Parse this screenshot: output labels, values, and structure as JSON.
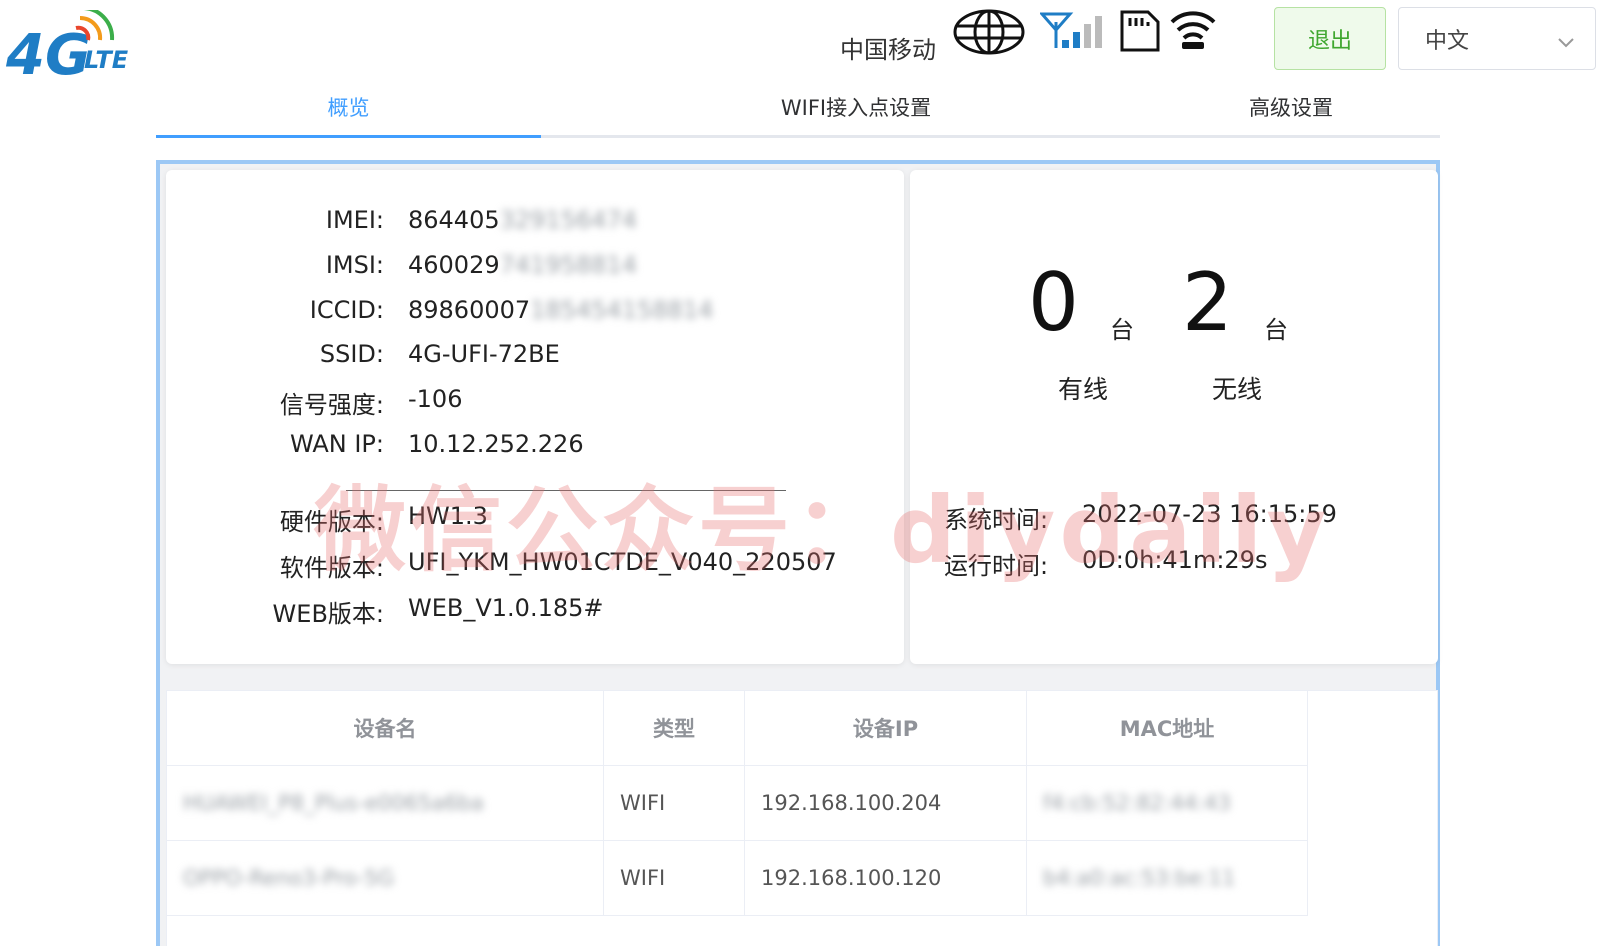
{
  "header": {
    "logo_text": "4G LTE",
    "operator": "中国移动",
    "logout_label": "退出",
    "language": "中文"
  },
  "tabs": [
    {
      "label": "概览",
      "active": true
    },
    {
      "label": "WIFI接入点设置",
      "active": false
    },
    {
      "label": "高级设置",
      "active": false
    }
  ],
  "info": {
    "imei": {
      "label": "IMEI:",
      "value": "864405",
      "hidden": "329156474"
    },
    "imsi": {
      "label": "IMSI:",
      "value": "460029",
      "hidden": "741958814"
    },
    "iccid": {
      "label": "ICCID:",
      "value": "89860007",
      "hidden": "185454158814"
    },
    "ssid": {
      "label": "SSID:",
      "value": "4G-UFI-72BE"
    },
    "signal": {
      "label": "信号强度:",
      "value": "-106"
    },
    "wan_ip": {
      "label": "WAN IP:",
      "value": "10.12.252.226"
    },
    "hw_version": {
      "label": "硬件版本:",
      "value": "HW1.3"
    },
    "sw_version": {
      "label": "软件版本:",
      "value": "UFI_YKM_HW01CTDE_V040_220507"
    },
    "web_version": {
      "label": "WEB版本:",
      "value": "WEB_V1.0.185#"
    }
  },
  "devices": {
    "wired_count": "0",
    "wireless_count": "2",
    "unit": "台",
    "wired_label": "有线",
    "wireless_label": "无线",
    "system_time_label": "系统时间:",
    "system_time": "2022-07-23 16:15:59",
    "uptime_label": "运行时间:",
    "uptime": "0D:0h:41m:29s"
  },
  "table": {
    "headers": [
      "设备名",
      "类型",
      "设备IP",
      "MAC地址"
    ],
    "rows": [
      {
        "name": "HUAWEI_P8_Plus-e0065a6ba",
        "type": "WIFI",
        "ip": "192.168.100.204",
        "mac": "f4:cb:52:82:44:43"
      },
      {
        "name": "OPPO-Reno3-Pro-5G",
        "type": "WIFI",
        "ip": "192.168.100.120",
        "mac": "b4:a0:ac:53:be:11"
      }
    ]
  },
  "watermark": "微信公众号：diydaily",
  "colors": {
    "accent": "#409eff",
    "logo_blue": "#1f7dc5",
    "logout_green": "#3fa72f",
    "watermark": "#e76e6e"
  }
}
